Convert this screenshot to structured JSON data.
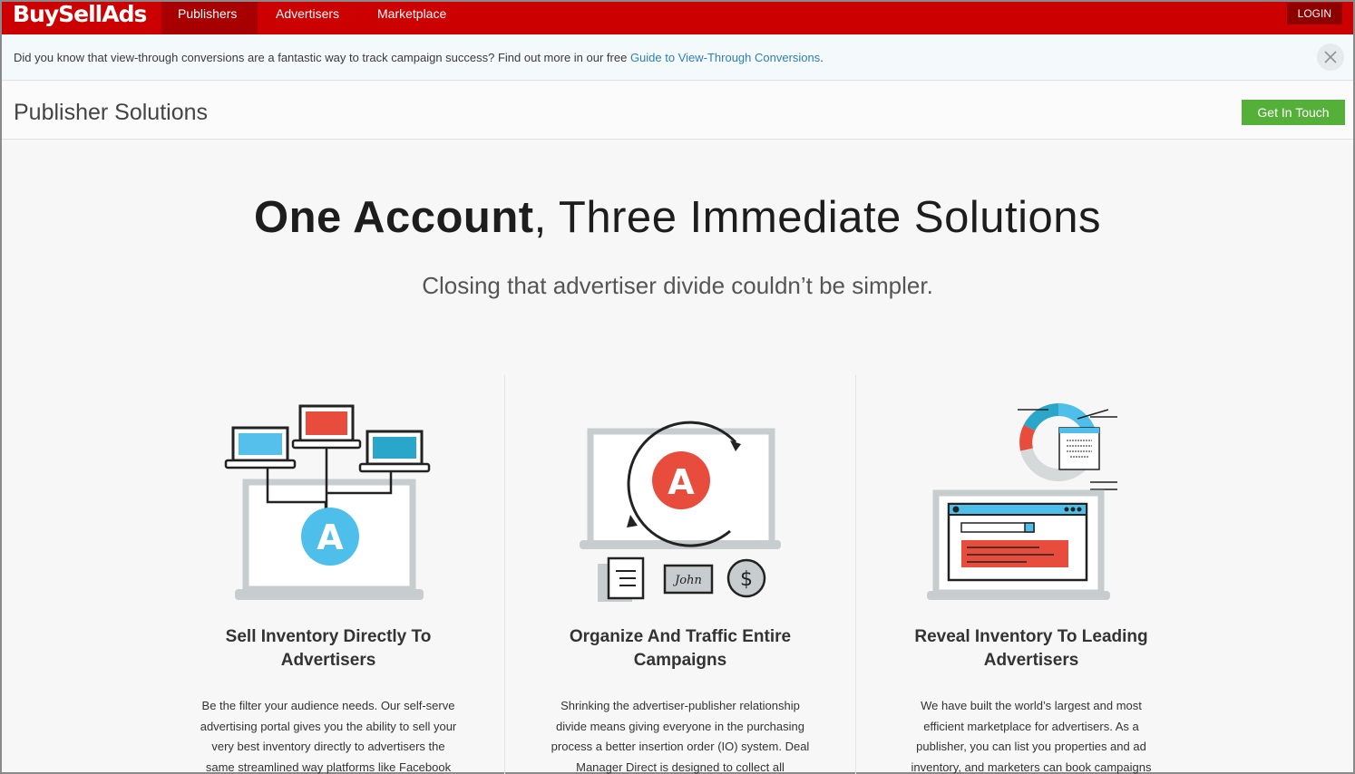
{
  "nav": {
    "brand": "BuySellAds",
    "links": [
      "Publishers",
      "Advertisers",
      "Marketplace"
    ],
    "login": "LOGIN"
  },
  "notice": {
    "text": "Did you know that view-through conversions are a fantastic way to track campaign success? Find out more in our free ",
    "link": "Guide to View-Through Conversions",
    "after": "."
  },
  "page": {
    "title": "Publisher Solutions",
    "cta": "Get In Touch"
  },
  "hero": {
    "title_bold": "One Account",
    "title_rest": ", Three Immediate Solutions",
    "subtitle": "Closing that advertiser divide couldn’t be simpler."
  },
  "features": [
    {
      "title_line1": "Sell Inventory Directly To",
      "title_line2": "Advertisers",
      "lines": [
        "Be the filter your audience needs. Our self-serve",
        "advertising portal gives you the ability to sell your",
        "very best inventory directly to advertisers the",
        "same streamlined way platforms like Facebook"
      ]
    },
    {
      "title_line1": "Organize And Traffic Entire",
      "title_line2": "Campaigns",
      "lines": [
        "Shrinking the advertiser-publisher relationship",
        "divide means giving everyone in the purchasing",
        "process a better insertion order (IO) system. Deal",
        "Manager Direct is designed to collect all"
      ]
    },
    {
      "title_line1": "Reveal Inventory To Leading",
      "title_line2": "Advertisers",
      "lines": [
        "We have built the world’s largest and most",
        "efficient marketplace for advertisers. As a",
        "publisher, you can list you properties and ad",
        "inventory, and marketers can book campaigns"
      ]
    }
  ],
  "illustration": {
    "logo_letter": "A",
    "signature": "John",
    "currency": "$"
  }
}
